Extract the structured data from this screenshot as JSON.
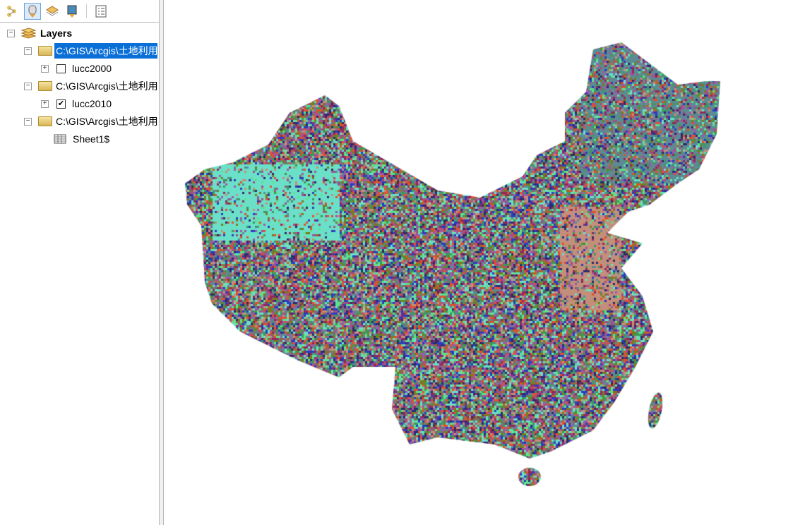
{
  "toc": {
    "toolbar": [
      {
        "name": "list-by-drawing-order",
        "icon": "layers-tree-icon"
      },
      {
        "name": "list-by-source",
        "icon": "database-icon",
        "active": true
      },
      {
        "name": "list-by-visibility",
        "icon": "layer-stack-icon"
      },
      {
        "name": "list-by-selection",
        "icon": "selection-icon"
      },
      {
        "name": "options",
        "icon": "options-list-icon"
      }
    ],
    "root_label": "Layers",
    "groups": [
      {
        "path": "C:\\GIS\\Arcgis\\土地利用",
        "selected": true,
        "layer": "lucc2000",
        "checked": false
      },
      {
        "path": "C:\\GIS\\Arcgis\\土地利用",
        "selected": false,
        "layer": "lucc2010",
        "checked": true
      },
      {
        "path": "C:\\GIS\\Arcgis\\土地利用",
        "selected": false,
        "table": "Sheet1$"
      }
    ]
  },
  "map": {
    "layer_colors": [
      "#6be0c8",
      "#8e2a5e",
      "#3a9a5a",
      "#c48f7a",
      "#5b8b93",
      "#2e2a6a",
      "#9b5aa5",
      "#5fe08a",
      "#2c3cc0",
      "#e05030",
      "#7a7a20",
      "#a05080"
    ]
  }
}
